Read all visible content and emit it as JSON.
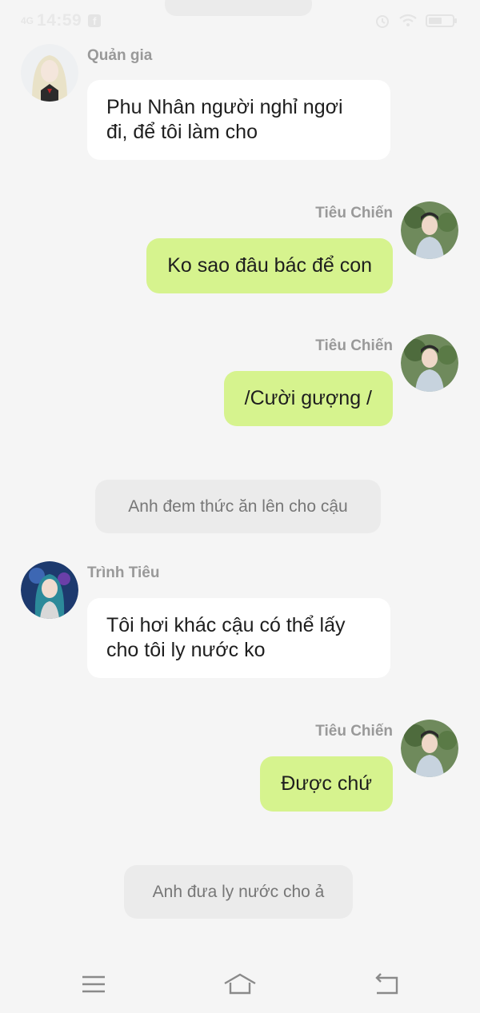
{
  "status_bar": {
    "network": "4G",
    "time": "14:59",
    "notification_app": "f",
    "icons": [
      "alarm-icon",
      "wifi-icon",
      "battery-icon"
    ]
  },
  "chat": {
    "messages": [
      {
        "speaker": "Quản gia",
        "side": "left",
        "text_lines": [
          "Phu Nhân người nghỉ ngơi",
          "đi, để tôi làm cho"
        ]
      },
      {
        "speaker": "Tiêu Chiến",
        "side": "right",
        "text": "Ko sao đâu bác để con"
      },
      {
        "speaker": "Tiêu Chiến",
        "side": "right",
        "text": "/Cười gượng /"
      },
      {
        "narration": "Anh đem thức ăn lên cho cậu"
      },
      {
        "speaker": "Trình Tiêu",
        "side": "left",
        "text_lines": [
          "Tôi hơi khác cậu có thể lấy",
          "cho tôi ly nước ko"
        ]
      },
      {
        "speaker": "Tiêu Chiến",
        "side": "right",
        "text": "Được chứ"
      },
      {
        "narration": "Anh đưa ly nước cho ả"
      }
    ]
  },
  "colors": {
    "background": "#f5f5f5",
    "incoming_bubble": "#ffffff",
    "outgoing_bubble": "#d6f38e",
    "narration_bubble": "#ebebeb",
    "speaker_name": "#999999"
  },
  "nav_bar": {
    "buttons": [
      "menu-icon",
      "home-icon",
      "back-icon"
    ]
  }
}
